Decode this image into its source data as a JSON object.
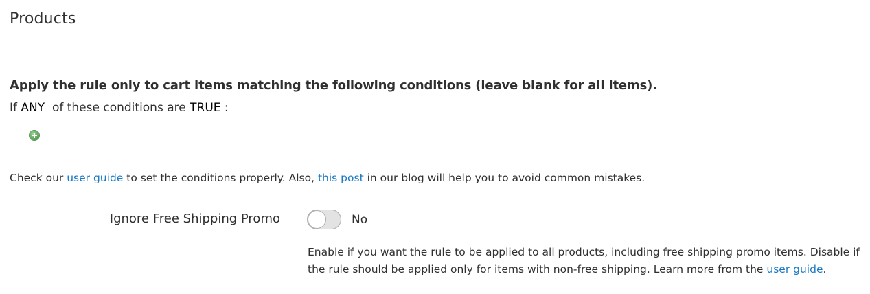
{
  "section": {
    "title": "Products"
  },
  "conditions": {
    "heading": "Apply the rule only to cart items matching the following conditions (leave blank for all items).",
    "prefix": "If",
    "aggregator": "ANY",
    "middle": "of these conditions are",
    "value": "TRUE",
    "suffix": ":",
    "add_icon": "add-circle-icon"
  },
  "guide": {
    "text_1": "Check our",
    "link_1": "user guide",
    "text_2": "to set the conditions properly. Also,",
    "link_2": "this post",
    "text_3": "in our blog will help you to avoid common mistakes."
  },
  "ignore_free_shipping": {
    "label": "Ignore Free Shipping Promo",
    "state_text": "No",
    "enabled": false,
    "note_text": "Enable if you want the rule to be applied to all products, including free shipping promo items. Disable if the rule should be applied only for items with non-free shipping. Learn more from the",
    "note_link": "user guide",
    "note_end": "."
  },
  "colors": {
    "text": "#303030",
    "link": "#1979c3",
    "add_icon": "#5da85a",
    "toggle_off": "#e3e3e3"
  }
}
